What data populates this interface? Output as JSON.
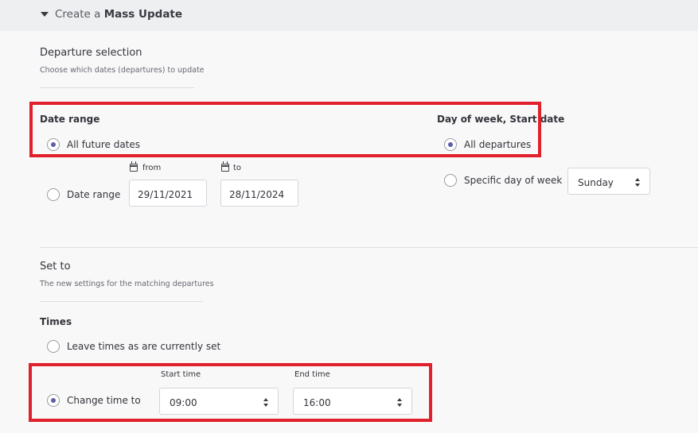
{
  "header": {
    "title_prefix": "Create a",
    "title_bold": "Mass Update"
  },
  "departure": {
    "title": "Departure selection",
    "subtitle": "Choose which dates (departures) to update",
    "date_range_group": "Date range",
    "option_all_future": "All future dates",
    "option_date_range": "Date range",
    "from_label": "from",
    "to_label": "to",
    "from_value": "29/11/2021",
    "to_value": "28/11/2024",
    "dow_group": "Day of week, Start date",
    "option_all_departures": "All departures",
    "option_specific_day": "Specific day of week",
    "day_select_value": "Sunday"
  },
  "set_to": {
    "title": "Set to",
    "subtitle": "The new settings for the matching departures",
    "times_group": "Times",
    "option_leave_times": "Leave times as are currently set",
    "option_change_time": "Change time to",
    "start_time_label": "Start time",
    "end_time_label": "End time",
    "start_time_value": "09:00",
    "end_time_value": "16:00"
  },
  "colors": {
    "highlight": "#e0202b",
    "radio_selected": "#5c5fa8"
  }
}
